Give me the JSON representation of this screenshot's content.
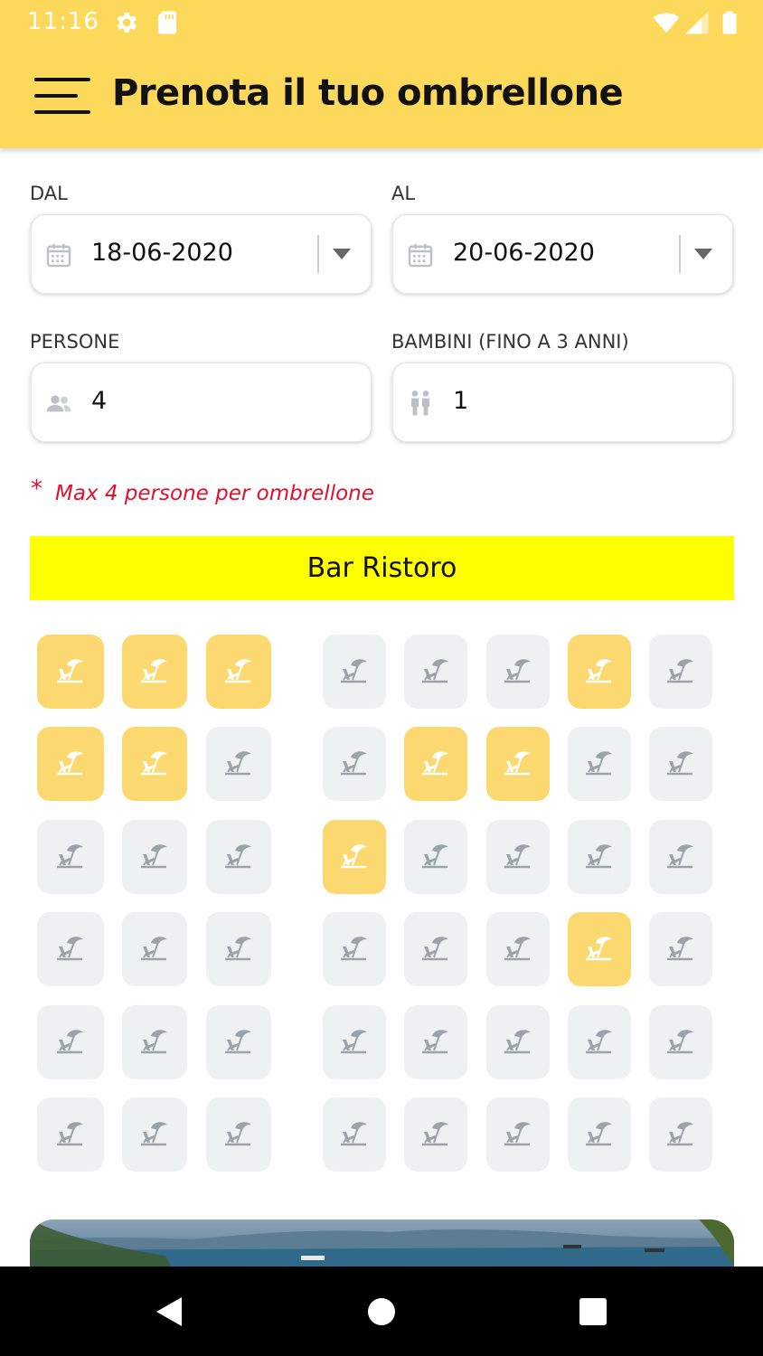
{
  "status_bar": {
    "time": "11:16"
  },
  "app_bar": {
    "title": "Prenota il tuo ombrellone",
    "menu_icon": "hamburger-menu-icon"
  },
  "form": {
    "from": {
      "label": "DAL",
      "value": "18-06-2020"
    },
    "to": {
      "label": "AL",
      "value": "20-06-2020"
    },
    "people": {
      "label": "PERSONE",
      "value": "4"
    },
    "children": {
      "label": "BAMBINI (FINO A 3 ANNI)",
      "value": "1"
    }
  },
  "note": {
    "star": "*",
    "text": "Max 4 persone per ombrellone"
  },
  "bar_ristoro": {
    "label": "Bar Ristoro"
  },
  "colors": {
    "app_bar": "#FCD95A",
    "booked": "#FCD970",
    "free": "#EEF1F2",
    "note": "#E0102F",
    "bar": "#FFFF00"
  },
  "umbrella_grid": {
    "rows": [
      [
        true,
        true,
        true,
        false,
        false,
        false,
        true,
        false
      ],
      [
        true,
        true,
        false,
        false,
        true,
        true,
        false,
        false
      ],
      [
        false,
        false,
        false,
        true,
        false,
        false,
        false,
        false
      ],
      [
        false,
        false,
        false,
        false,
        false,
        false,
        true,
        false
      ],
      [
        false,
        false,
        false,
        false,
        false,
        false,
        false,
        false
      ],
      [
        false,
        false,
        false,
        false,
        false,
        false,
        false,
        false
      ]
    ]
  }
}
